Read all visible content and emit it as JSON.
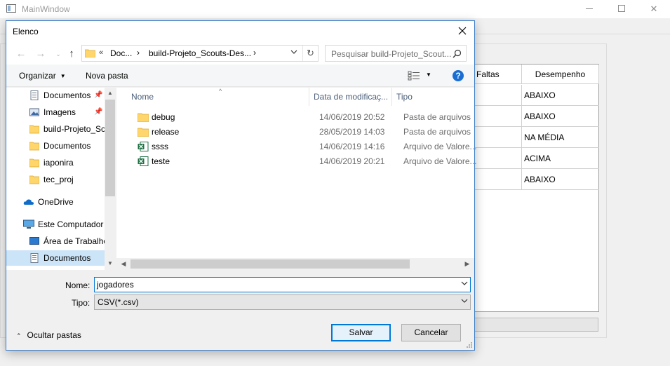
{
  "main_window": {
    "title": "MainWindow",
    "table": {
      "headers": [
        "Faltas",
        "Desempenho"
      ],
      "desempenho": [
        "ABAIXO",
        "ABAIXO",
        "NA MÉDIA",
        "ACIMA",
        "ABAIXO"
      ]
    }
  },
  "dialog": {
    "title": "Elenco",
    "address": {
      "overflow": "«",
      "segments": [
        "Doc...",
        "build-Projeto_Scouts-Des..."
      ]
    },
    "search_placeholder": "Pesquisar build-Projeto_Scout...",
    "toolbar": {
      "organize": "Organizar",
      "new_folder": "Nova pasta"
    },
    "nav_items": [
      {
        "label": "Documentos",
        "icon": "documents-icon",
        "pinned": true
      },
      {
        "label": "Imagens",
        "icon": "pictures-icon",
        "pinned": true
      },
      {
        "label": "build-Projeto_Sc",
        "icon": "folder-icon"
      },
      {
        "label": "Documentos",
        "icon": "folder-icon"
      },
      {
        "label": "iaponira",
        "icon": "folder-icon"
      },
      {
        "label": "tec_proj",
        "icon": "folder-icon"
      },
      {
        "label": "OneDrive",
        "icon": "cloud-icon"
      },
      {
        "label": "Este Computador",
        "icon": "computer-icon"
      },
      {
        "label": "Área de Trabalho",
        "icon": "desktop-icon"
      },
      {
        "label": "Documentos",
        "icon": "documents-icon"
      }
    ],
    "columns": {
      "name": "Nome",
      "date": "Data de modificaç...",
      "type": "Tipo"
    },
    "files": [
      {
        "name": "debug",
        "date": "14/06/2019 20:52",
        "type": "Pasta de arquivos",
        "icon": "folder-icon"
      },
      {
        "name": "release",
        "date": "28/05/2019 14:03",
        "type": "Pasta de arquivos",
        "icon": "folder-icon"
      },
      {
        "name": "ssss",
        "date": "14/06/2019 14:16",
        "type": "Arquivo de Valore...",
        "icon": "excel-csv-icon"
      },
      {
        "name": "teste",
        "date": "14/06/2019 20:21",
        "type": "Arquivo de Valore...",
        "icon": "excel-csv-icon"
      }
    ],
    "filename_label": "Nome:",
    "filename_value": "jogadores",
    "filetype_label": "Tipo:",
    "filetype_value": "CSV(*.csv)",
    "hide_folders": "Ocultar pastas",
    "save_button": "Salvar",
    "cancel_button": "Cancelar"
  },
  "colors": {
    "accent": "#0078d7",
    "folder": "#ffd66b",
    "selection": "#cce4f7"
  }
}
